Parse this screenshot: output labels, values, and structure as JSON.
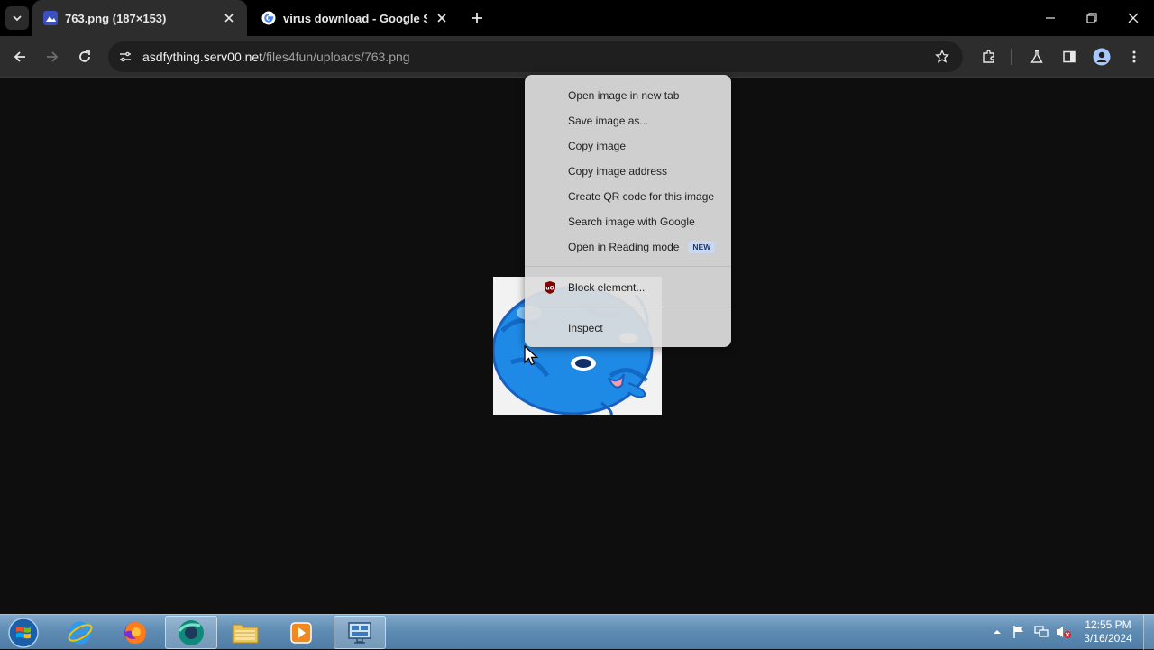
{
  "browser": {
    "tabs": [
      {
        "title": "763.png (187×153)",
        "active": true,
        "favicon": "image-favicon-icon"
      },
      {
        "title": "virus download - Google Search",
        "active": false,
        "favicon": "google-g-icon"
      }
    ],
    "address_bar": {
      "host": "asdfything.serv00.net",
      "path": "/files4fun/uploads/763.png"
    }
  },
  "context_menu": {
    "items": [
      {
        "label": "Open image in new tab"
      },
      {
        "label": "Save image as..."
      },
      {
        "label": "Copy image"
      },
      {
        "label": "Copy image address"
      },
      {
        "label": "Create QR code for this image"
      },
      {
        "label": "Search image with Google"
      },
      {
        "label": "Open in Reading mode",
        "badge": "NEW"
      },
      {
        "label": "Block element...",
        "icon": "ublock-origin-icon"
      },
      {
        "label": "Inspect"
      }
    ]
  },
  "taskbar": {
    "apps": [
      "internet-explorer",
      "firefox",
      "chromium-based-browser",
      "file-explorer",
      "media-player",
      "task-manager"
    ],
    "clock": {
      "time": "12:55 PM",
      "date": "3/16/2024"
    }
  },
  "colors": {
    "tab_strip": "#000000",
    "toolbar": "#2d2d2d",
    "page_background": "#0e0e0e",
    "context_menu": "#dedede",
    "taskbar": "#5f8cb3",
    "cat_blue": "#1f8ae6"
  }
}
